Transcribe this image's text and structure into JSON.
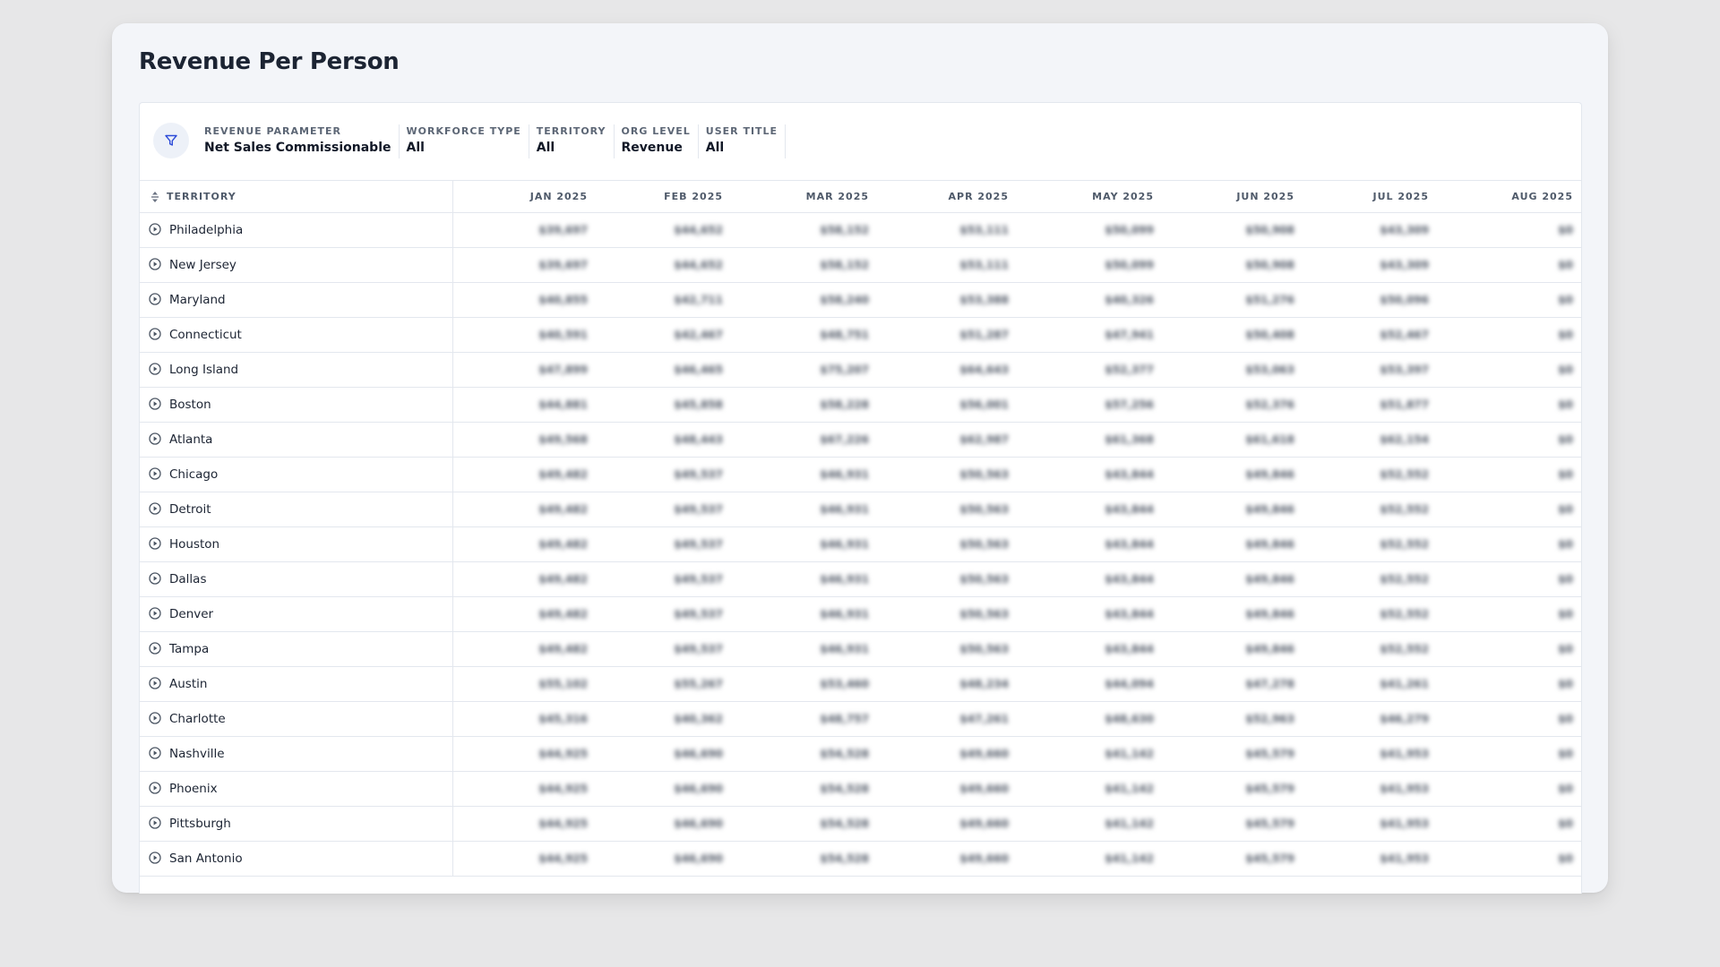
{
  "title": "Revenue Per Person",
  "filters": [
    {
      "label": "Revenue Parameter",
      "value": "Net Sales Commissionable"
    },
    {
      "label": "Workforce Type",
      "value": "All"
    },
    {
      "label": "Territory",
      "value": "All"
    },
    {
      "label": "Org Level",
      "value": "Revenue"
    },
    {
      "label": "User Title",
      "value": "All"
    }
  ],
  "table": {
    "territory_header": "Territory",
    "months": [
      "Jan 2025",
      "Feb 2025",
      "Mar 2025",
      "Apr 2025",
      "May 2025",
      "Jun 2025",
      "Jul 2025",
      "Aug 2025"
    ],
    "rows": [
      {
        "name": "Philadelphia",
        "values": [
          "$39,697",
          "$44,652",
          "$58,152",
          "$53,111",
          "$50,099",
          "$50,908",
          "$43,309",
          "$0"
        ]
      },
      {
        "name": "New Jersey",
        "values": [
          "$39,697",
          "$44,652",
          "$58,152",
          "$53,111",
          "$50,099",
          "$50,908",
          "$43,309",
          "$0"
        ]
      },
      {
        "name": "Maryland",
        "values": [
          "$40,855",
          "$42,711",
          "$58,240",
          "$53,388",
          "$40,326",
          "$51,276",
          "$50,096",
          "$0"
        ]
      },
      {
        "name": "Connecticut",
        "values": [
          "$40,591",
          "$42,467",
          "$48,751",
          "$51,287",
          "$47,941",
          "$50,408",
          "$52,467",
          "$0"
        ]
      },
      {
        "name": "Long Island",
        "values": [
          "$47,899",
          "$46,465",
          "$75,207",
          "$64,643",
          "$52,377",
          "$53,063",
          "$53,397",
          "$0"
        ]
      },
      {
        "name": "Boston",
        "values": [
          "$44,881",
          "$45,858",
          "$58,228",
          "$56,001",
          "$57,256",
          "$52,376",
          "$51,877",
          "$0"
        ]
      },
      {
        "name": "Atlanta",
        "values": [
          "$49,568",
          "$48,443",
          "$67,226",
          "$62,987",
          "$61,368",
          "$61,618",
          "$62,154",
          "$0"
        ]
      },
      {
        "name": "Chicago",
        "values": [
          "$49,482",
          "$49,537",
          "$46,931",
          "$50,563",
          "$43,844",
          "$49,846",
          "$52,552",
          "$0"
        ]
      },
      {
        "name": "Detroit",
        "values": [
          "$49,482",
          "$49,537",
          "$46,931",
          "$50,563",
          "$43,844",
          "$49,846",
          "$52,552",
          "$0"
        ]
      },
      {
        "name": "Houston",
        "values": [
          "$49,482",
          "$49,537",
          "$46,931",
          "$50,563",
          "$43,844",
          "$49,846",
          "$52,552",
          "$0"
        ]
      },
      {
        "name": "Dallas",
        "values": [
          "$49,482",
          "$49,537",
          "$46,931",
          "$50,563",
          "$43,844",
          "$49,846",
          "$52,552",
          "$0"
        ]
      },
      {
        "name": "Denver",
        "values": [
          "$49,482",
          "$49,537",
          "$46,931",
          "$50,563",
          "$43,844",
          "$49,846",
          "$52,552",
          "$0"
        ]
      },
      {
        "name": "Tampa",
        "values": [
          "$49,482",
          "$49,537",
          "$46,931",
          "$50,563",
          "$43,844",
          "$49,846",
          "$52,552",
          "$0"
        ]
      },
      {
        "name": "Austin",
        "values": [
          "$55,102",
          "$55,267",
          "$53,460",
          "$48,234",
          "$44,094",
          "$47,278",
          "$41,261",
          "$0"
        ]
      },
      {
        "name": "Charlotte",
        "values": [
          "$45,316",
          "$40,362",
          "$48,757",
          "$47,261",
          "$48,630",
          "$52,963",
          "$46,279",
          "$0"
        ]
      },
      {
        "name": "Nashville",
        "values": [
          "$44,925",
          "$46,690",
          "$54,528",
          "$49,660",
          "$41,142",
          "$45,579",
          "$41,953",
          "$0"
        ]
      },
      {
        "name": "Phoenix",
        "values": [
          "$44,925",
          "$46,690",
          "$54,528",
          "$49,660",
          "$41,142",
          "$45,579",
          "$41,953",
          "$0"
        ]
      },
      {
        "name": "Pittsburgh",
        "values": [
          "$44,925",
          "$46,690",
          "$54,528",
          "$49,660",
          "$41,142",
          "$45,579",
          "$41,953",
          "$0"
        ]
      },
      {
        "name": "San Antonio",
        "values": [
          "$44,925",
          "$46,690",
          "$54,528",
          "$49,660",
          "$41,142",
          "$45,579",
          "$41,953",
          "$0"
        ]
      }
    ]
  },
  "icons": {
    "filter": "filter-icon",
    "sort": "sort-icon",
    "expand": "play-circle-icon"
  },
  "colors": {
    "accent": "#2c4bd8",
    "text": "#1c2433"
  }
}
